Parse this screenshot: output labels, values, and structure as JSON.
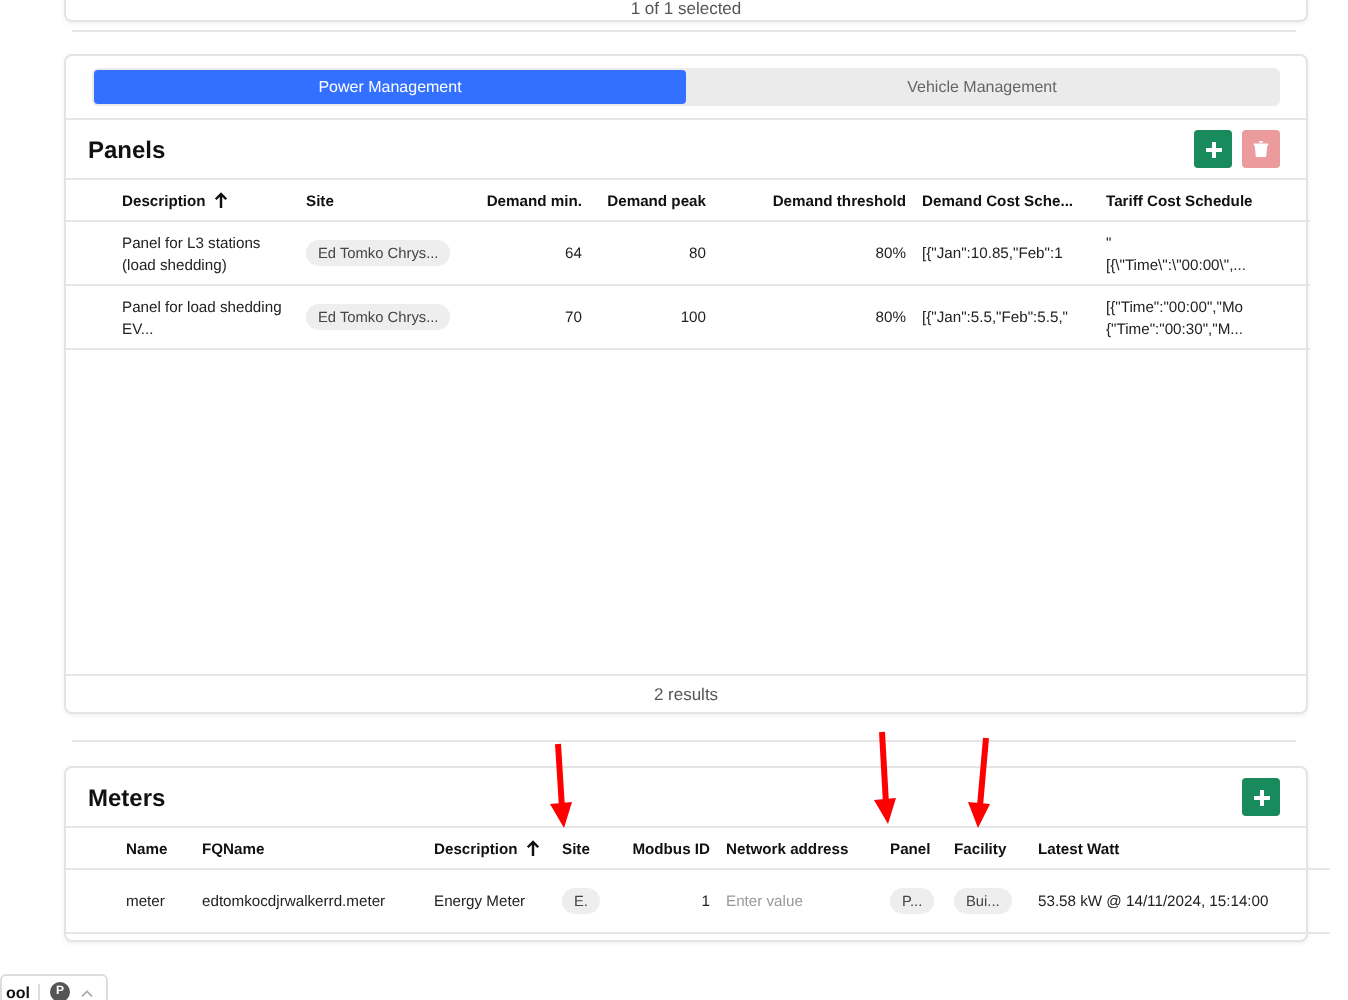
{
  "selection_footer": {
    "text": "1 of 1 selected"
  },
  "tabs": [
    {
      "label": "Power Management",
      "selected": true
    },
    {
      "label": "Vehicle Management",
      "selected": false
    }
  ],
  "panels": {
    "title": "Panels",
    "actions": [
      {
        "kind": "add",
        "disabled": false
      },
      {
        "kind": "delete",
        "disabled": true
      }
    ],
    "columns": [
      {
        "label": "Description",
        "sorted": true
      },
      {
        "label": "Site",
        "sorted": false
      },
      {
        "label": "Demand min.",
        "sorted": false
      },
      {
        "label": "Demand peak",
        "sorted": false
      },
      {
        "label": "Demand threshold",
        "sorted": false
      },
      {
        "label": "Demand Cost Sche...",
        "sorted": false
      },
      {
        "label": "Tariff Cost Schedule",
        "sorted": false
      }
    ],
    "rows": [
      {
        "cells": [
          {
            "kind": "text",
            "text": "Panel for L3 stations (load shedding)"
          },
          {
            "kind": "chip",
            "text": "Ed Tomko Chrys..."
          },
          {
            "kind": "number",
            "text": "64"
          },
          {
            "kind": "number",
            "text": "80"
          },
          {
            "kind": "number",
            "text": "80%"
          },
          {
            "kind": "text",
            "text": "[{\"Jan\":10.85,\"Feb\":1"
          },
          {
            "kind": "text",
            "text": "\"\n[{\\\"Time\\\":\\\"00:00\\\",..."
          }
        ]
      },
      {
        "cells": [
          {
            "kind": "text",
            "text": "Panel for load shedding EV..."
          },
          {
            "kind": "chip",
            "text": "Ed Tomko Chrys..."
          },
          {
            "kind": "number",
            "text": "70"
          },
          {
            "kind": "number",
            "text": "100"
          },
          {
            "kind": "number",
            "text": "80%"
          },
          {
            "kind": "text",
            "text": "[{\"Jan\":5.5,\"Feb\":5.5,\""
          },
          {
            "kind": "text",
            "text": "[{\"Time\":\"00:00\",\"Mo\n{\"Time\":\"00:30\",\"M..."
          }
        ]
      }
    ],
    "footer": "2 results"
  },
  "meters": {
    "title": "Meters",
    "actions": [
      {
        "kind": "add",
        "disabled": false
      }
    ],
    "columns": [
      {
        "label": "Name",
        "sorted": false
      },
      {
        "label": "FQName",
        "sorted": false
      },
      {
        "label": "Description",
        "sorted": true
      },
      {
        "label": "Site",
        "sorted": false
      },
      {
        "label": "Modbus ID",
        "sorted": false
      },
      {
        "label": "Network address",
        "sorted": false
      },
      {
        "label": "Panel",
        "sorted": false
      },
      {
        "label": "Facility",
        "sorted": false
      },
      {
        "label": "Latest Watt",
        "sorted": false
      }
    ],
    "rows": [
      {
        "cells": [
          {
            "kind": "text",
            "text": "meter"
          },
          {
            "kind": "text",
            "text": "edtomkocdjrwalkerrd.meter"
          },
          {
            "kind": "text",
            "text": "Energy Meter"
          },
          {
            "kind": "chip",
            "text": "E."
          },
          {
            "kind": "number",
            "text": "1"
          },
          {
            "kind": "input",
            "placeholder": "Enter value"
          },
          {
            "kind": "chip",
            "text": "P..."
          },
          {
            "kind": "chip",
            "text": "Bui..."
          },
          {
            "kind": "text",
            "text": "53.58 kW @ 14/11/2024, 15:14:00"
          }
        ]
      }
    ]
  },
  "bottom_pill": {
    "text": "ool",
    "avatar": "P"
  }
}
